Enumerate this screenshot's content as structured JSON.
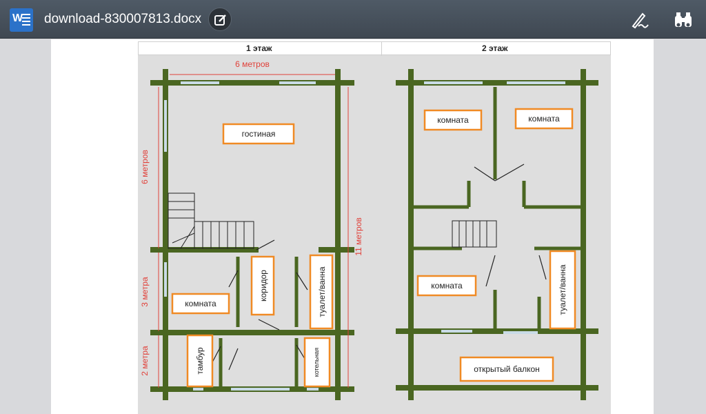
{
  "app": {
    "document_title": "download-830007813.docx",
    "icons": [
      "word-app-icon",
      "edit-icon",
      "ink-pen-icon",
      "binoculars-icon"
    ]
  },
  "figure": {
    "floor1": {
      "title": "1 этаж",
      "rooms": [
        "гостиная",
        "комната",
        "коридор",
        "туалет/ванна",
        "тамбур",
        "котельная"
      ],
      "dimensions": {
        "top": "6 метров",
        "left_upper": "6 метров",
        "left_middle": "3 метра",
        "left_lower": "2 метра",
        "right_total": "11 метров"
      }
    },
    "floor2": {
      "title": "2 этаж",
      "rooms": [
        "комната",
        "комната",
        "комната",
        "туалет/ванна",
        "открытый балкон"
      ]
    },
    "colors": {
      "wall": "#4a6621",
      "window": "#c9dbe6",
      "room_border": "#f08a24",
      "dimension": "#e0413a"
    }
  }
}
